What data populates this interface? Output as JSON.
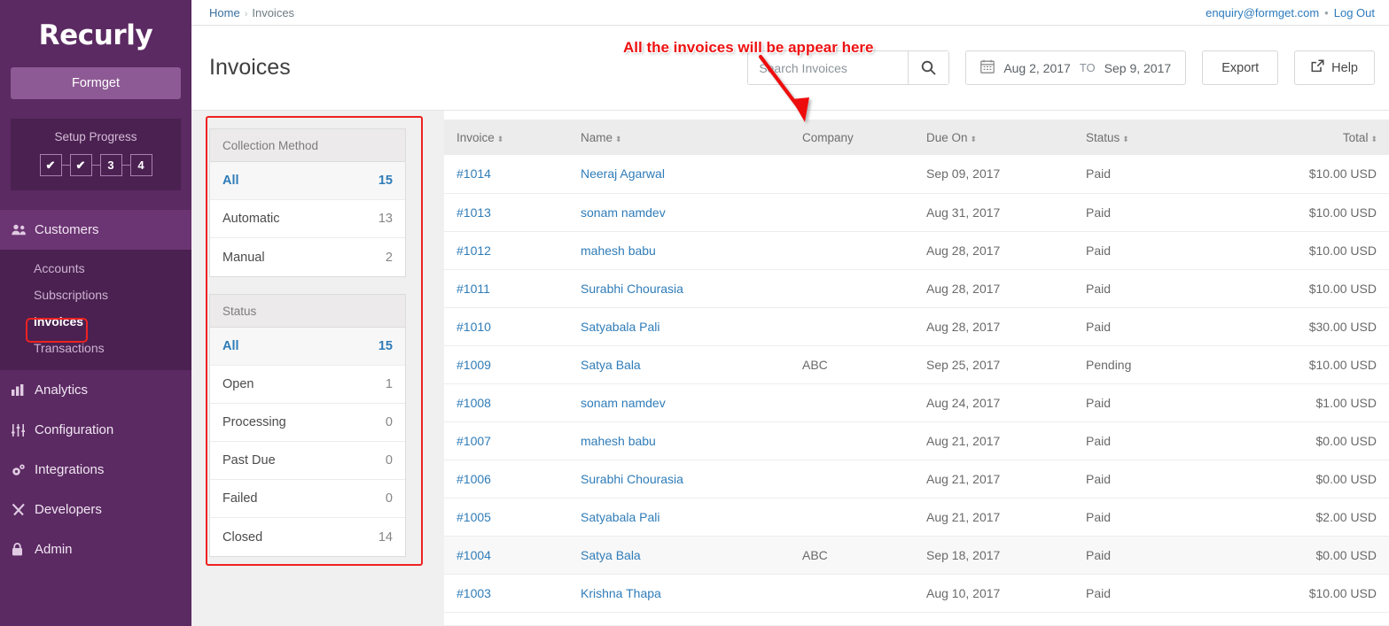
{
  "sidebar": {
    "logo": "Recurly",
    "account_button": "Formget",
    "setup": {
      "title": "Setup Progress",
      "steps": [
        "✔",
        "✔",
        "3",
        "4"
      ]
    },
    "nav": [
      {
        "label": "Customers",
        "icon": "people-icon",
        "active": true
      },
      {
        "label": "Analytics",
        "icon": "bar-chart-icon",
        "active": false
      },
      {
        "label": "Configuration",
        "icon": "sliders-icon",
        "active": false
      },
      {
        "label": "Integrations",
        "icon": "gears-icon",
        "active": false
      },
      {
        "label": "Developers",
        "icon": "tools-icon",
        "active": false
      },
      {
        "label": "Admin",
        "icon": "lock-icon",
        "active": false
      }
    ],
    "submenu": [
      {
        "label": "Accounts",
        "current": false
      },
      {
        "label": "Subscriptions",
        "current": false
      },
      {
        "label": "Invoices",
        "current": true
      },
      {
        "label": "Transactions",
        "current": false
      }
    ]
  },
  "topbar": {
    "breadcrumb_home": "Home",
    "breadcrumb_sep": "›",
    "breadcrumb_current": "Invoices",
    "user_email": "enquiry@formget.com",
    "separator": "•",
    "logout": "Log Out"
  },
  "pagehead": {
    "title": "Invoices",
    "search_placeholder": "Search Invoices",
    "search_value": "",
    "date_from": "Aug 2, 2017",
    "date_to_label": "TO",
    "date_to": "Sep 9, 2017",
    "export_label": "Export",
    "help_label": "Help"
  },
  "filters": [
    {
      "title": "Collection Method",
      "rows": [
        {
          "label": "All",
          "count": "15",
          "selected": true
        },
        {
          "label": "Automatic",
          "count": "13",
          "selected": false
        },
        {
          "label": "Manual",
          "count": "2",
          "selected": false
        }
      ]
    },
    {
      "title": "Status",
      "rows": [
        {
          "label": "All",
          "count": "15",
          "selected": true
        },
        {
          "label": "Open",
          "count": "1",
          "selected": false
        },
        {
          "label": "Processing",
          "count": "0",
          "selected": false
        },
        {
          "label": "Past Due",
          "count": "0",
          "selected": false
        },
        {
          "label": "Failed",
          "count": "0",
          "selected": false
        },
        {
          "label": "Closed",
          "count": "14",
          "selected": false
        }
      ]
    }
  ],
  "table": {
    "columns": [
      {
        "label": "Invoice",
        "sortable": true,
        "align": "left"
      },
      {
        "label": "Name",
        "sortable": true,
        "align": "left"
      },
      {
        "label": "Company",
        "sortable": false,
        "align": "left"
      },
      {
        "label": "Due On",
        "sortable": true,
        "align": "left"
      },
      {
        "label": "Status",
        "sortable": true,
        "align": "left"
      },
      {
        "label": "Total",
        "sortable": true,
        "align": "right"
      }
    ],
    "rows": [
      {
        "invoice": "#1014",
        "name": "Neeraj Agarwal",
        "company": "",
        "due": "Sep 09, 2017",
        "status": "Paid",
        "total": "$10.00 USD",
        "alt": false
      },
      {
        "invoice": "#1013",
        "name": "sonam namdev",
        "company": "",
        "due": "Aug 31, 2017",
        "status": "Paid",
        "total": "$10.00 USD",
        "alt": false
      },
      {
        "invoice": "#1012",
        "name": "mahesh babu",
        "company": "",
        "due": "Aug 28, 2017",
        "status": "Paid",
        "total": "$10.00 USD",
        "alt": false
      },
      {
        "invoice": "#1011",
        "name": "Surabhi Chourasia",
        "company": "",
        "due": "Aug 28, 2017",
        "status": "Paid",
        "total": "$10.00 USD",
        "alt": false
      },
      {
        "invoice": "#1010",
        "name": "Satyabala Pali",
        "company": "",
        "due": "Aug 28, 2017",
        "status": "Paid",
        "total": "$30.00 USD",
        "alt": false
      },
      {
        "invoice": "#1009",
        "name": "Satya Bala",
        "company": "ABC",
        "due": "Sep 25, 2017",
        "status": "Pending",
        "total": "$10.00 USD",
        "alt": false
      },
      {
        "invoice": "#1008",
        "name": "sonam namdev",
        "company": "",
        "due": "Aug 24, 2017",
        "status": "Paid",
        "total": "$1.00 USD",
        "alt": false
      },
      {
        "invoice": "#1007",
        "name": "mahesh babu",
        "company": "",
        "due": "Aug 21, 2017",
        "status": "Paid",
        "total": "$0.00 USD",
        "alt": false
      },
      {
        "invoice": "#1006",
        "name": "Surabhi Chourasia",
        "company": "",
        "due": "Aug 21, 2017",
        "status": "Paid",
        "total": "$0.00 USD",
        "alt": false
      },
      {
        "invoice": "#1005",
        "name": "Satyabala Pali",
        "company": "",
        "due": "Aug 21, 2017",
        "status": "Paid",
        "total": "$2.00 USD",
        "alt": false
      },
      {
        "invoice": "#1004",
        "name": "Satya Bala",
        "company": "ABC",
        "due": "Sep 18, 2017",
        "status": "Paid",
        "total": "$0.00 USD",
        "alt": true
      },
      {
        "invoice": "#1003",
        "name": "Krishna Thapa",
        "company": "",
        "due": "Aug 10, 2017",
        "status": "Paid",
        "total": "$10.00 USD",
        "alt": false
      }
    ]
  },
  "annotation": {
    "text": "All the invoices will be appear here",
    "color": "#ee1111"
  },
  "colors": {
    "sidebar_bg": "#5b2a62",
    "submenu_bg": "#4a2150",
    "accent_link": "#2f7cb8",
    "annotation_red": "#ee1111"
  }
}
